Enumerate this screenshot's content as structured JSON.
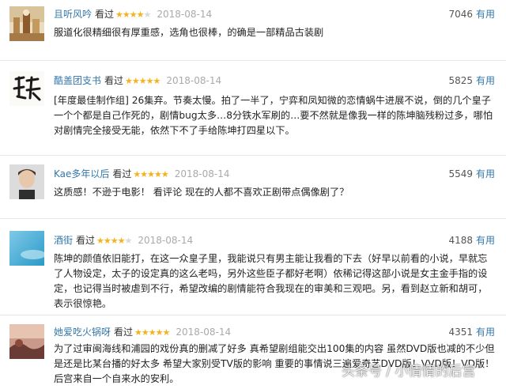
{
  "reviews": [
    {
      "user": "且听风吟",
      "watched": "看过",
      "stars": 4,
      "date": "2018-08-14",
      "votes": "7046",
      "useful": "有用",
      "content": "服道化很精细很有厚重感，选角也很棒，的确是一部精品古装剧",
      "avatar": "still-life-photo"
    },
    {
      "user": "酷盖团支书",
      "watched": "看过",
      "stars": 5,
      "date": "2018-08-14",
      "votes": "5825",
      "useful": "有用",
      "content": "[年度最佳制作组] 26集弃。节奏太慢。拍了一半了，宁弈和凤知微的恋情蜗牛进展不说，倒的几个皇子一个个都是自己作死的，剧情bug太多…8分铁水军刷的…要不然就是像我一样的陈坤脑残粉过多，哪怕对剧情完全接受无能，依然下不了手给陈坤打四星以下。",
      "avatar": "calligraphy-avatar"
    },
    {
      "user": "Kae多年以后",
      "watched": "看过",
      "stars": 5,
      "date": "2018-08-14",
      "votes": "5549",
      "useful": "有用",
      "content": "这质感！不逊于电影！ 看评论 现在的人都不喜欢正剧带点偶像剧了？",
      "avatar": "portrait-avatar"
    },
    {
      "user": "酒街",
      "watched": "看过",
      "stars": 4,
      "date": "2018-08-14",
      "votes": "4188",
      "useful": "有用",
      "content": "陈坤的颜值依旧能打，在这一众皇子里，我能说只有男主能让我看的下去（好早以前看的小说，早就忘了人物设定，太子的设定真的这么老吗，另外这些臣子都好老啊）依稀记得这部小说是女主金手指的设定，也记得当时被虐到不行，希望改编的剧情能符合我现在的审美和三观吧。另，看到赵立新和胡可，表示很惊艳。",
      "avatar": "sky-avatar"
    },
    {
      "user": "她爱吃火锅呀",
      "watched": "看过",
      "stars": 5,
      "date": "2018-08-14",
      "votes": "4351",
      "useful": "有用",
      "content": "为了过审闽海线和浦园的戏份真的删减了好多 真希望剧组能交出100集的内容 虽然DVD版也减的不少但是还是比某台播的好太多 希望大家别受TV版的影响 重要的事情说三遍爱奇艺DVD版！VVD版！VD版！后宫来自一个自来水的安利。",
      "avatar": "landscape-avatar"
    }
  ],
  "watermark": "头条号 / 小情情的后宫",
  "colors": {
    "link": "#3377aa",
    "star": "#f6b21b",
    "date": "#aaaaaa"
  }
}
